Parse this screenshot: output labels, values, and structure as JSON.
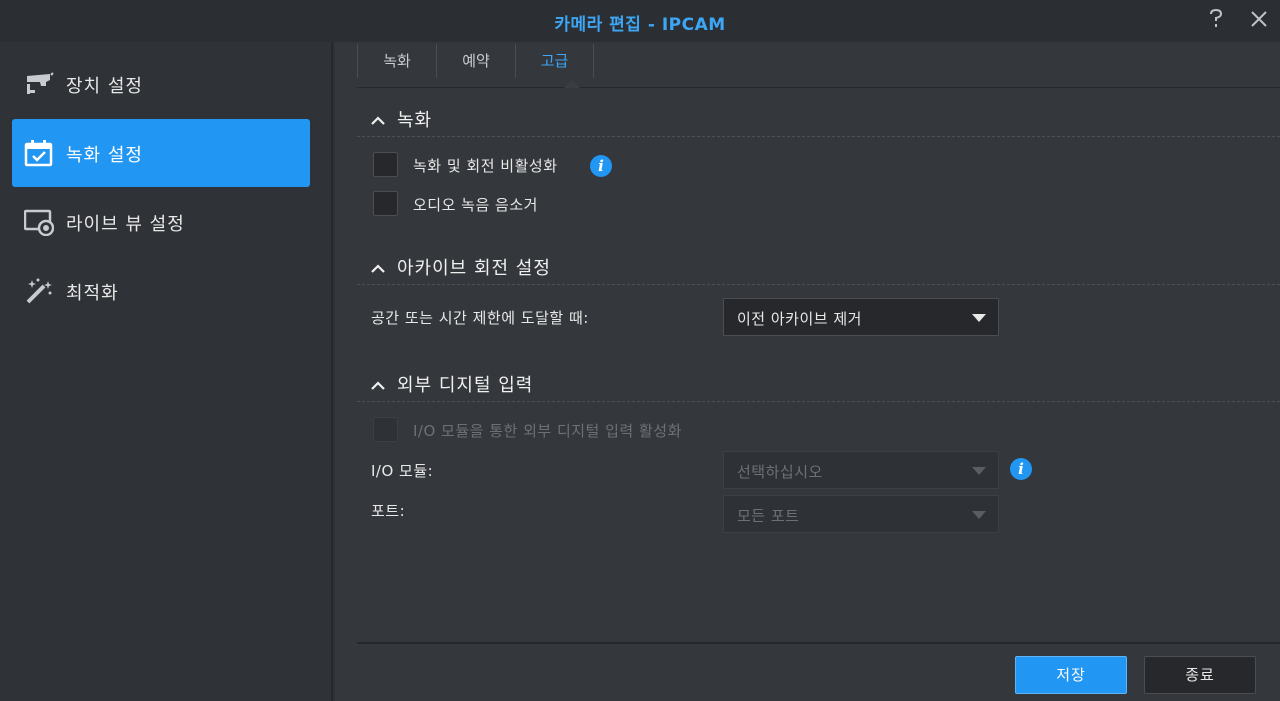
{
  "window": {
    "title_main": "카메라 편집",
    "title_sep": " - ",
    "title_camera": "IPCAM",
    "help_icon": "question-mark-icon",
    "close_icon": "close-icon"
  },
  "sidebar": {
    "items": [
      {
        "label": "장치 설정",
        "icon": "camera-icon",
        "active": false
      },
      {
        "label": "녹화 설정",
        "icon": "calendar-check-icon",
        "active": true
      },
      {
        "label": "라이브 뷰 설정",
        "icon": "monitor-record-icon",
        "active": false
      },
      {
        "label": "최적화",
        "icon": "magic-wand-icon",
        "active": false
      }
    ]
  },
  "tabs": [
    {
      "label": "녹화",
      "active": false
    },
    {
      "label": "예약",
      "active": false
    },
    {
      "label": "고급",
      "active": true
    }
  ],
  "recording": {
    "heading": "녹화",
    "disable_rotation_label": "녹화 및 회전 비활성화",
    "mute_audio_label": "오디오 녹음 음소거"
  },
  "archive": {
    "heading": "아카이브 회전 설정",
    "limit_label": "공간 또는 시간 제한에 도달할 때:",
    "limit_value": "이전 아카이브 제거"
  },
  "digital_input": {
    "heading": "외부 디지털 입력",
    "enable_label": "I/O 모듈을 통한 외부 디지털 입력 활성화",
    "module_label": "I/O 모듈:",
    "module_placeholder": "선택하십시오",
    "port_label": "포트:",
    "port_value": "모든 포트"
  },
  "footer": {
    "save_label": "저장",
    "close_label": "종료"
  },
  "colors": {
    "accent": "#2196f3",
    "title": "#3da6f5",
    "background": "#34373b"
  }
}
